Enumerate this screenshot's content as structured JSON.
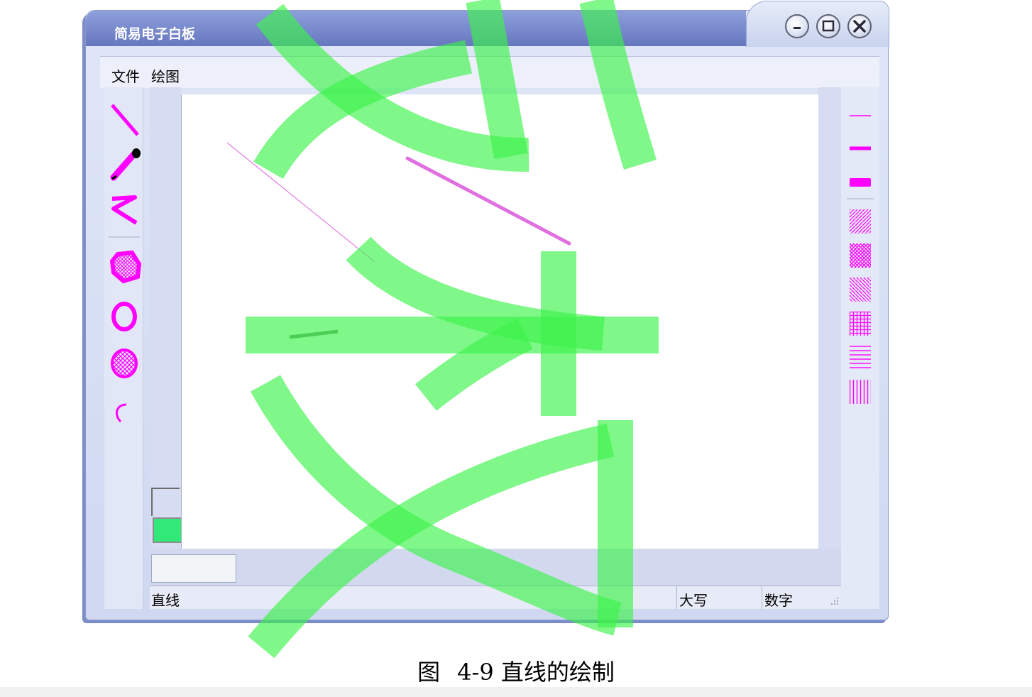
{
  "window": {
    "title": "简易电子白板"
  },
  "menu": {
    "items": [
      "文件",
      "绘图"
    ]
  },
  "toolbox": {
    "tools": [
      "line-tool",
      "pen-tool",
      "polyline-tool",
      "filled-polygon-tool",
      "ellipse-tool",
      "filled-ellipse-tool",
      "arc-tool"
    ]
  },
  "colors": {
    "foreground": "#d6dcf2",
    "background": "#31e878",
    "accent": "#ff00ff"
  },
  "status": {
    "mode": "直线",
    "caps": "大写",
    "num": "数字"
  },
  "caption": {
    "figure_label": "图",
    "figure_number": "4-9",
    "text": "直线的绘制"
  }
}
